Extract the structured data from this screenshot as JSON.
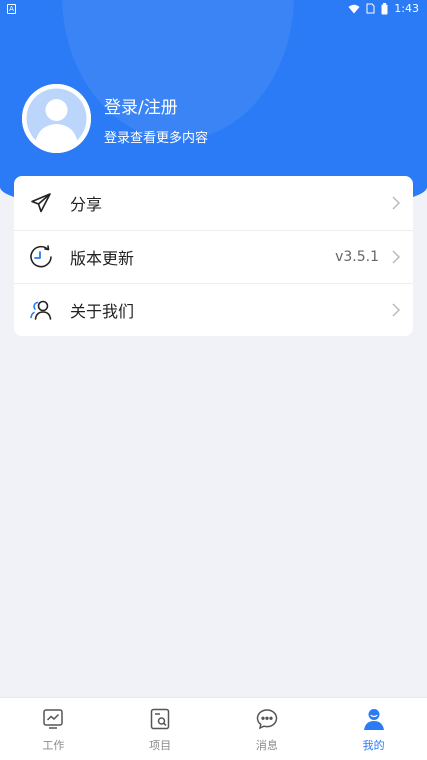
{
  "status_bar": {
    "time": "1:43",
    "left_badge": "A"
  },
  "profile": {
    "title": "登录/注册",
    "subtitle": "登录查看更多内容"
  },
  "menu": [
    {
      "label": "分享",
      "value": "",
      "icon": "paper-plane-icon"
    },
    {
      "label": "版本更新",
      "value": "v3.5.1",
      "icon": "refresh-clock-icon"
    },
    {
      "label": "关于我们",
      "value": "",
      "icon": "users-icon"
    }
  ],
  "tabs": [
    {
      "label": "工作",
      "icon": "chart-monitor-icon"
    },
    {
      "label": "项目",
      "icon": "document-search-icon"
    },
    {
      "label": "消息",
      "icon": "chat-bubble-icon"
    },
    {
      "label": "我的",
      "icon": "person-icon",
      "active": true
    }
  ],
  "colors": {
    "primary": "#2c7bf6",
    "background": "#f0f2f7"
  }
}
